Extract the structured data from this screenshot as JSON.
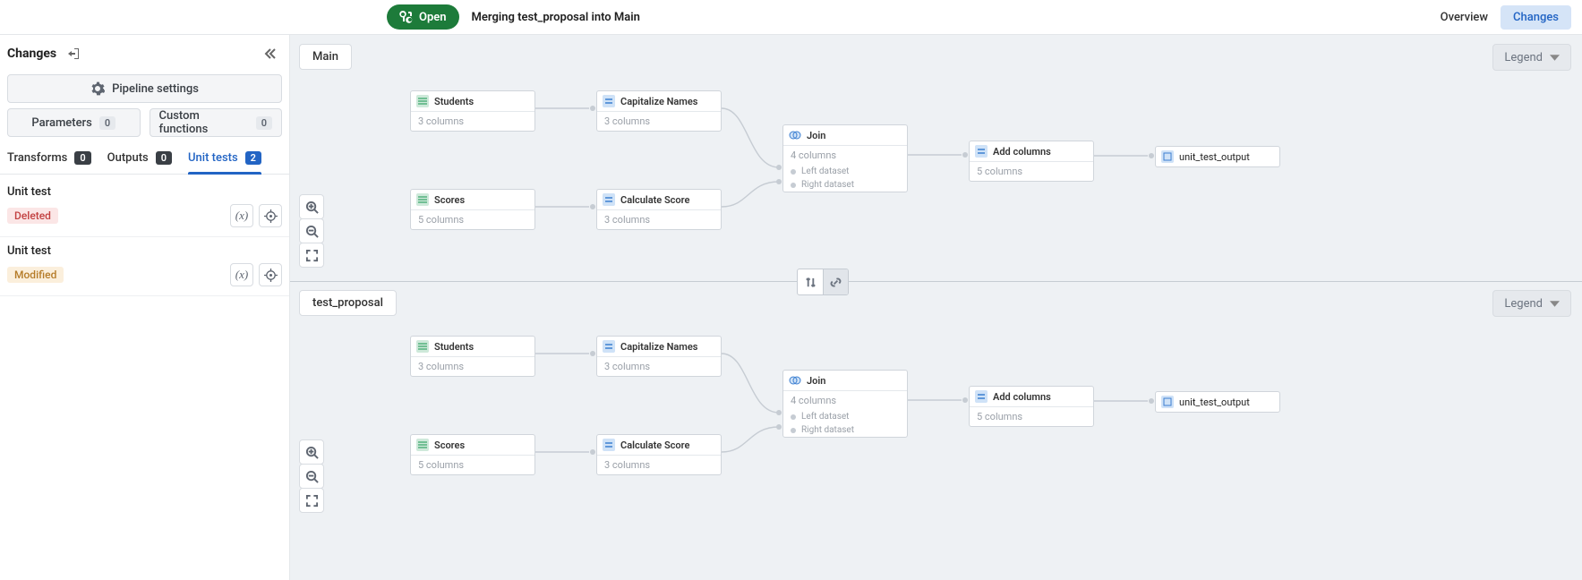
{
  "header": {
    "open_label": "Open",
    "merge_text": "Merging test_proposal into Main",
    "tabs": {
      "overview": "Overview",
      "changes": "Changes"
    }
  },
  "sidebar": {
    "title": "Changes",
    "pipeline_settings_label": "Pipeline settings",
    "parameters": {
      "label": "Parameters",
      "count": "0"
    },
    "custom_functions": {
      "label": "Custom functions",
      "count": "0"
    },
    "tabs": {
      "transforms": {
        "label": "Transforms",
        "count": "0"
      },
      "outputs": {
        "label": "Outputs",
        "count": "0"
      },
      "unit_tests": {
        "label": "Unit tests",
        "count": "2"
      }
    },
    "units": [
      {
        "name": "Unit test",
        "status": "Deleted"
      },
      {
        "name": "Unit test",
        "status": "Modified"
      }
    ]
  },
  "canvas": {
    "panel_top": "Main",
    "panel_bottom": "test_proposal",
    "legend": "Legend",
    "nodes": {
      "students": {
        "title": "Students",
        "sub": "3 columns"
      },
      "scores": {
        "title": "Scores",
        "sub": "5 columns"
      },
      "capitalize": {
        "title": "Capitalize Names",
        "sub": "3 columns"
      },
      "calc": {
        "title": "Calculate Score",
        "sub": "3 columns"
      },
      "join": {
        "title": "Join",
        "sub": "4 columns",
        "port_left": "Left dataset",
        "port_right": "Right dataset"
      },
      "addcols": {
        "title": "Add columns",
        "sub": "5 columns"
      },
      "output": {
        "title": "unit_test_output"
      }
    }
  }
}
